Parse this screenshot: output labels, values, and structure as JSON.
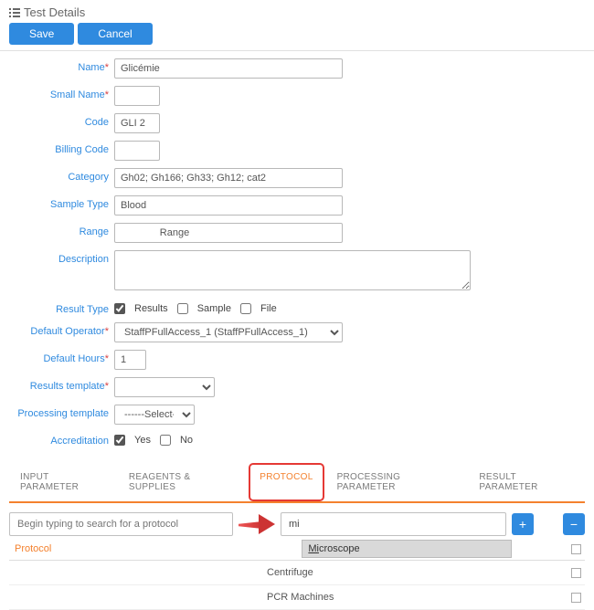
{
  "header": {
    "title": "Test Details"
  },
  "buttons": {
    "save": "Save",
    "cancel": "Cancel"
  },
  "form": {
    "name": {
      "label": "Name",
      "value": "Glicémie",
      "required": true
    },
    "small_name": {
      "label": "Small Name",
      "value": "",
      "required": true
    },
    "code": {
      "label": "Code",
      "value": "GLI 2"
    },
    "billing_code": {
      "label": "Billing Code",
      "value": ""
    },
    "category": {
      "label": "Category",
      "value": "Gh02; Gh166; Gh33; Gh12; cat2"
    },
    "sample_type": {
      "label": "Sample Type",
      "value": "Blood"
    },
    "range": {
      "label": "Range",
      "value": "              Range"
    },
    "description": {
      "label": "Description",
      "value": ""
    },
    "result_type": {
      "label": "Result Type",
      "options": {
        "results": "Results",
        "sample": "Sample",
        "file": "File"
      }
    },
    "default_operator": {
      "label": "Default Operator",
      "required": true,
      "value": "StaffPFullAccess_1  (StaffPFullAccess_1)"
    },
    "default_hours": {
      "label": "Default Hours",
      "value": "1",
      "required": true
    },
    "results_template": {
      "label": "Results template",
      "value": "           ",
      "required": true
    },
    "processing_template": {
      "label": "Processing template",
      "value": "------Select------"
    },
    "accreditation": {
      "label": "Accreditation",
      "yes": "Yes",
      "no": "No"
    }
  },
  "tabs": {
    "input_parameter": "INPUT PARAMETER",
    "reagents": "REAGENTS & SUPPLIES",
    "protocol": "PROTOCOL",
    "processing_parameter": "PROCESSING PARAMETER",
    "result_parameter": "RESULT PARAMETER"
  },
  "protocol_panel": {
    "search_placeholder": "Begin typing to search for a protocol",
    "search_value": "mi",
    "header_label": "Protocol",
    "dropdown_match_prefix": "Mi",
    "dropdown_match_rest": "croscope",
    "rows": [
      {
        "name": "Centrifuge"
      },
      {
        "name": "PCR Machines"
      }
    ],
    "plus": "+",
    "minus": "−"
  }
}
